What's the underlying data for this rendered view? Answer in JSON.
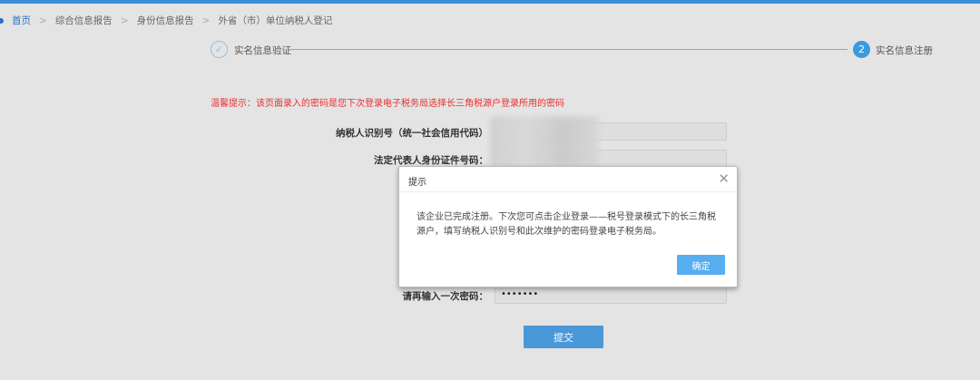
{
  "breadcrumb": [
    "首页",
    "综合信息报告",
    "身份信息报告",
    "外省（市）单位纳税人登记"
  ],
  "steps": [
    {
      "label": "实名信息验证",
      "icon": "check-icon"
    },
    {
      "label": "实名信息注册",
      "number": "2"
    }
  ],
  "warning": "温馨提示：该页面录入的密码是您下次登录电子税务局选择长三角税源户登录所用的密码",
  "form": {
    "taxpayer_id_label": "纳税人识别号（统一社会信用代码）",
    "legal_rep_id_label": "法定代表人身份证件号码：",
    "confirm_password_label": "请再输入一次密码：",
    "confirm_password_value": "•••••••",
    "submit": "提交"
  },
  "dialog": {
    "title": "提示",
    "message": "该企业已完成注册。下次您可点击企业登录——税号登录模式下的长三角税源户，填写纳税人识别号和此次维护的密码登录电子税务局。",
    "ok": "确定",
    "close": "✕"
  },
  "colors": {
    "accent": "#3a9ae0",
    "warning": "#e83030"
  }
}
